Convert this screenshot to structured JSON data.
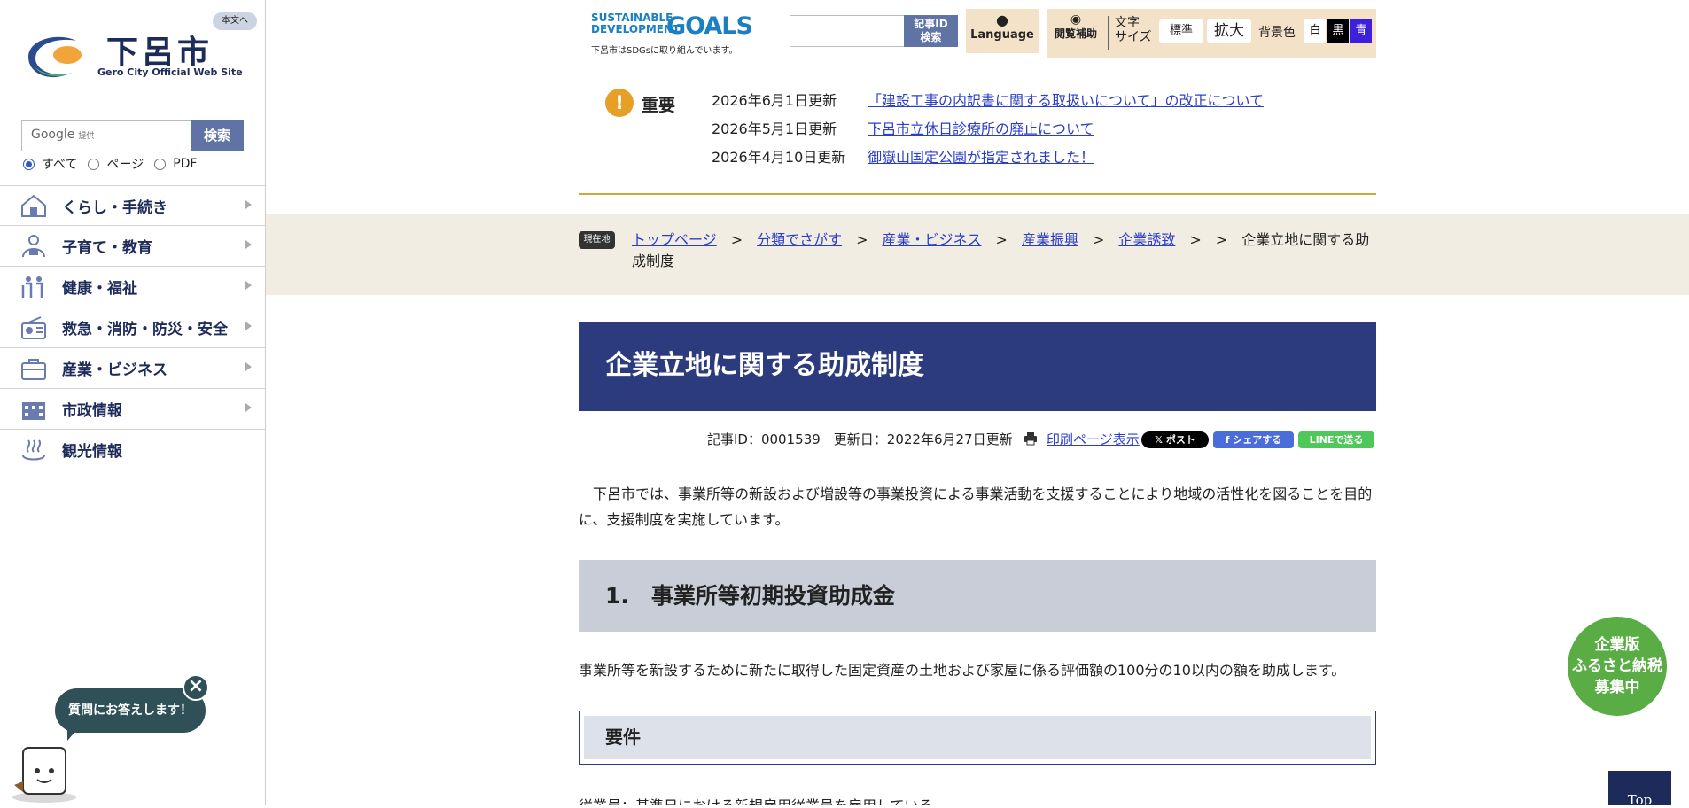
{
  "site": {
    "name": "下呂市",
    "subtitle": "Gero City Official Web Site",
    "skip_label": "本文へ"
  },
  "search": {
    "google_label": "Google",
    "google_small": "提供",
    "button": "検索",
    "options": [
      {
        "label": "すべて",
        "selected": true
      },
      {
        "label": "ページ",
        "selected": false
      },
      {
        "label": "PDF",
        "selected": false
      }
    ]
  },
  "nav": [
    {
      "label": "くらし・手続き",
      "icon": "house-icon"
    },
    {
      "label": "子育て・教育",
      "icon": "parent-child-icon"
    },
    {
      "label": "健康・福祉",
      "icon": "elderly-people-icon"
    },
    {
      "label": "救急・消防・防災・安全",
      "icon": "radio-icon"
    },
    {
      "label": "産業・ビジネス",
      "icon": "briefcase-icon"
    },
    {
      "label": "市政情報",
      "icon": "city-building-icon"
    },
    {
      "label": "観光情報",
      "icon": "hot-spring-icon"
    }
  ],
  "header": {
    "sdgs_line1": "SUSTAINABLE",
    "sdgs_line2": "DEVELOPMENT",
    "sdgs_goals": "GOALS",
    "sdgs_note": "下呂市はSDGsに取り組んでいます。",
    "article_id_btn_1": "記事ID",
    "article_id_btn_2": "検索",
    "language": "Language",
    "assist": "閲覧補助",
    "font_label_1": "文字",
    "font_label_2": "サイズ",
    "font_std": "標準",
    "font_big": "拡大",
    "bg_label": "背景色",
    "bg_white": "白",
    "bg_black": "黒",
    "bg_blue": "青"
  },
  "notices": {
    "label": "重要",
    "items": [
      {
        "date": "2026年6月1日更新",
        "text": "「建設工事の内訳書に関する取扱いについて」の改正について"
      },
      {
        "date": "2026年5月1日更新",
        "text": "下呂市立休日診療所の廃止について"
      },
      {
        "date": "2026年4月10日更新",
        "text": "御嶽山国定公園が指定されました！"
      }
    ]
  },
  "breadcrumb": {
    "here_label": "現在地",
    "items": [
      "トップページ",
      "分類でさがす",
      "産業・ビジネス",
      "産業振興",
      "企業誘致"
    ],
    "current": "企業立地に関する助成制度"
  },
  "article": {
    "title": "企業立地に関する助成制度",
    "meta": "記事ID：0001539　更新日：2022年6月27日更新",
    "print_link": "印刷ページ表示",
    "share_x": "𝕏 ポスト",
    "share_fb": "f シェアする",
    "share_line": "LINEで送る",
    "intro": "下呂市では、事業所等の新設および増設等の事業投資による事業活動を支援することにより地域の活性化を図ることを目的に、支援制度を実施しています。",
    "h2": "1.　事業所等初期投資助成金",
    "p1": "事業所等を新設するために新たに取得した固定資産の土地および家屋に係る評価額の100分の10以内の額を助成します。",
    "h3": "要件",
    "p2": "従業員：基準日における新規雇用従業員を雇用している"
  },
  "widgets": {
    "chat": "質問にお答えします！",
    "chat_close": "×",
    "furusato_1": "企業版",
    "furusato_2": "ふるさと納税",
    "furusato_3": "募集中",
    "top": "Top"
  }
}
